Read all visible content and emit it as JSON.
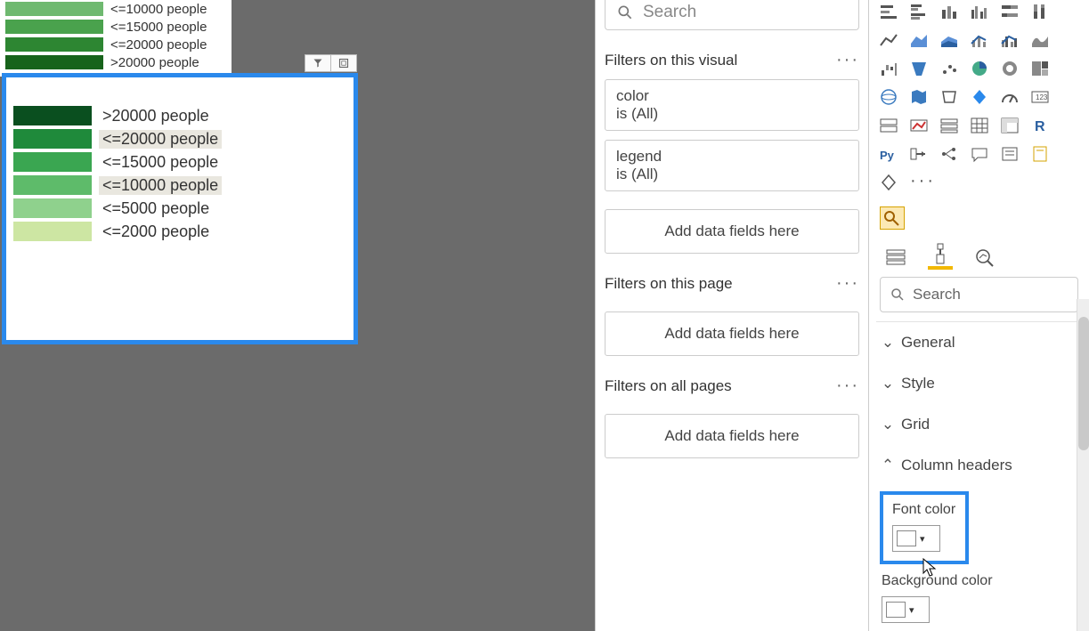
{
  "legend_top": [
    {
      "color": "#6fb970",
      "label": "<=10000 people"
    },
    {
      "color": "#4aa24d",
      "label": "<=15000 people"
    },
    {
      "color": "#2d8632",
      "label": "<=20000 people"
    },
    {
      "color": "#17631b",
      "label": ">20000 people"
    }
  ],
  "visual_legend": [
    {
      "color": "#0a4f1f",
      "label": ">20000 people",
      "hl": false
    },
    {
      "color": "#1f8a3b",
      "label": "<=20000 people",
      "hl": true
    },
    {
      "color": "#3aa651",
      "label": "<=15000 people",
      "hl": false
    },
    {
      "color": "#5ebb6a",
      "label": "<=10000 people",
      "hl": true
    },
    {
      "color": "#8fd18d",
      "label": "<=5000 people",
      "hl": false
    },
    {
      "color": "#cde6a3",
      "label": "<=2000 people",
      "hl": false
    }
  ],
  "filters": {
    "search_placeholder": "Search",
    "section_visual": "Filters on this visual",
    "cards": [
      {
        "name": "color",
        "value": "is (All)"
      },
      {
        "name": "legend",
        "value": "is (All)"
      }
    ],
    "add_here": "Add data fields here",
    "section_page": "Filters on this page",
    "section_all": "Filters on all pages"
  },
  "viz": {
    "search_placeholder": "Search",
    "sections": [
      {
        "label": "General",
        "open": false
      },
      {
        "label": "Style",
        "open": false
      },
      {
        "label": "Grid",
        "open": false
      },
      {
        "label": "Column headers",
        "open": true
      }
    ],
    "font_color_label": "Font color",
    "bg_color_label": "Background color"
  }
}
